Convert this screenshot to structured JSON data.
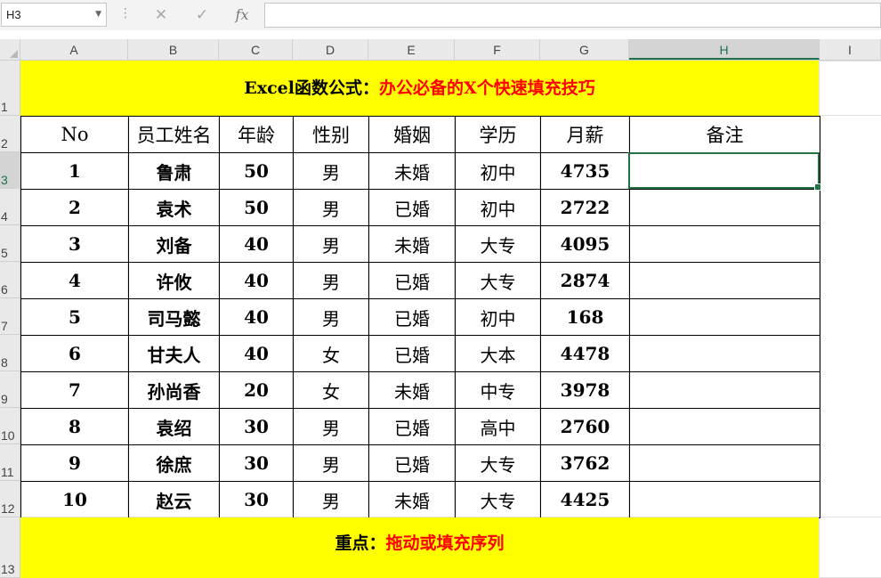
{
  "formula_bar": {
    "name_box": "H3",
    "formula": ""
  },
  "columns": [
    "A",
    "B",
    "C",
    "D",
    "E",
    "F",
    "G",
    "H",
    "I"
  ],
  "rows": [
    "1",
    "2",
    "3",
    "4",
    "5",
    "6",
    "7",
    "8",
    "9",
    "10",
    "11",
    "12",
    "13"
  ],
  "title": {
    "part1": "Excel函数公式：",
    "part2": "办公必备的X个快速填充技巧"
  },
  "table": {
    "headers": [
      "No",
      "员工姓名",
      "年龄",
      "性别",
      "婚姻",
      "学历",
      "月薪",
      "备注"
    ],
    "rows": [
      [
        "1",
        "鲁肃",
        "50",
        "男",
        "未婚",
        "初中",
        "4735",
        ""
      ],
      [
        "2",
        "袁术",
        "50",
        "男",
        "已婚",
        "初中",
        "2722",
        ""
      ],
      [
        "3",
        "刘备",
        "40",
        "男",
        "未婚",
        "大专",
        "4095",
        ""
      ],
      [
        "4",
        "许攸",
        "40",
        "男",
        "已婚",
        "大专",
        "2874",
        ""
      ],
      [
        "5",
        "司马懿",
        "40",
        "男",
        "已婚",
        "初中",
        "168",
        ""
      ],
      [
        "6",
        "甘夫人",
        "40",
        "女",
        "已婚",
        "大本",
        "4478",
        ""
      ],
      [
        "7",
        "孙尚香",
        "20",
        "女",
        "未婚",
        "中专",
        "3978",
        ""
      ],
      [
        "8",
        "袁绍",
        "30",
        "男",
        "已婚",
        "高中",
        "2760",
        ""
      ],
      [
        "9",
        "徐庶",
        "30",
        "男",
        "已婚",
        "大专",
        "3762",
        ""
      ],
      [
        "10",
        "赵云",
        "30",
        "男",
        "未婚",
        "大专",
        "4425",
        ""
      ]
    ]
  },
  "footer": {
    "part1": "重点：",
    "part2": "拖动或填充序列"
  },
  "selected_cell": "H3",
  "colors": {
    "banner": "#ffff00",
    "accent_red": "#ff0000",
    "selection": "#217346"
  },
  "icons": {
    "cancel": "close-icon",
    "enter": "check-icon",
    "function": "fx-icon"
  }
}
